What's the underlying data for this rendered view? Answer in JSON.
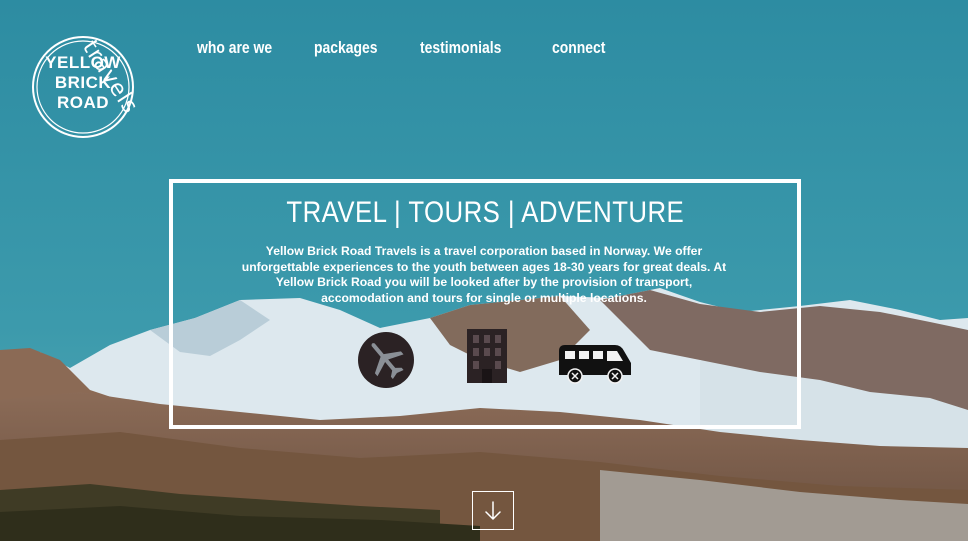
{
  "logo": {
    "line1": "YELLOW",
    "line2": "BRICK",
    "line3": "ROAD",
    "script": "travels"
  },
  "nav": {
    "items": [
      "who are we",
      "packages",
      "testimonials",
      "connect"
    ]
  },
  "hero": {
    "headline": "TRAVEL | TOURS | ADVENTURE",
    "description": "Yellow Brick Road Travels is a travel corporation based in Norway. We offer unforgettable experiences to the youth between ages 18-30 years for great deals. At Yellow Brick Road you will be looked after by the provision of transport, accomodation and tours for single or multiple locations.",
    "icons": [
      "airplane-icon",
      "building-icon",
      "van-icon"
    ]
  },
  "scroll": {
    "icon": "arrow-down-icon"
  },
  "colors": {
    "sky_top": "#2f8ea3",
    "sky_bottom": "#4fa6b4",
    "snow": "#dfeaef",
    "rock": "#8a6a57",
    "forest": "#3d3a24",
    "icon_dark": "#2b2224",
    "text": "#ffffff"
  }
}
